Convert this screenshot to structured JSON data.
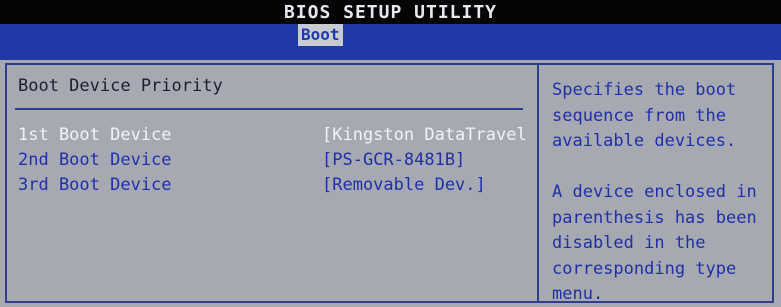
{
  "title": "BIOS SETUP UTILITY",
  "menu": {
    "active_tab": "Boot"
  },
  "section": {
    "title": "Boot Device Priority"
  },
  "boot_devices": [
    {
      "label": "1st Boot Device",
      "value": "[Kingston DataTravel"
    },
    {
      "label": "2nd Boot Device",
      "value": "[PS-GCR-8481B]"
    },
    {
      "label": "3rd Boot Device",
      "value": "[Removable Dev.]"
    }
  ],
  "help": {
    "para1": "Specifies the boot\nsequence from the\navailable devices.",
    "para2": "A device enclosed in\nparenthesis has been\ndisabled in the\ncorresponding type\nmenu."
  },
  "colors": {
    "header_blue": "#1f3aa8",
    "panel_gray": "#a7a9b2",
    "text_blue": "#1f2fa8",
    "selected_text": "#f2f3f7"
  }
}
